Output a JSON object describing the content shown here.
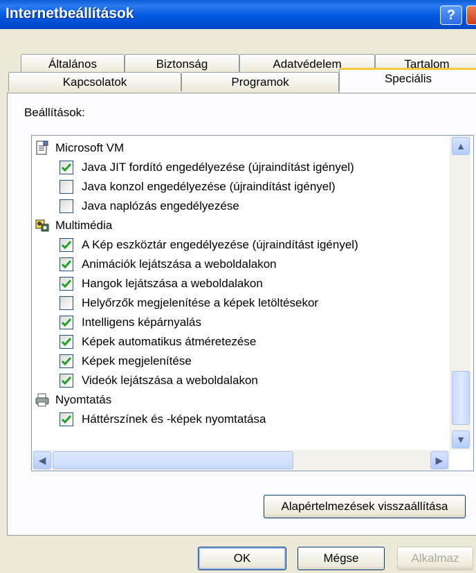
{
  "window": {
    "title": "Internetbeállítások"
  },
  "tabs_row1": [
    "Általános",
    "Biztonság",
    "Adatvédelem",
    "Tartalom"
  ],
  "tabs_row2": [
    "Kapcsolatok",
    "Programok",
    "Speciális"
  ],
  "panel": {
    "settings_label": "Beállítások:"
  },
  "list": [
    {
      "type": "category",
      "icon": "document-icon",
      "label": "Microsoft VM"
    },
    {
      "type": "checkbox",
      "checked": true,
      "label": "Java JIT fordító engedélyezése (újraindítást igényel)"
    },
    {
      "type": "checkbox",
      "checked": false,
      "label": "Java konzol engedélyezése (újraindítást igényel)"
    },
    {
      "type": "checkbox",
      "checked": false,
      "label": "Java naplózás engedélyezése"
    },
    {
      "type": "category",
      "icon": "multimedia-icon",
      "label": "Multimédia"
    },
    {
      "type": "checkbox",
      "checked": true,
      "label": "A Kép eszköztár engedélyezése (újraindítást igényel)"
    },
    {
      "type": "checkbox",
      "checked": true,
      "label": "Animációk lejátszása a weboldalakon"
    },
    {
      "type": "checkbox",
      "checked": true,
      "label": "Hangok lejátszása a weboldalakon"
    },
    {
      "type": "checkbox",
      "checked": false,
      "label": "Helyőrzők megjelenítése a képek letöltésekor"
    },
    {
      "type": "checkbox",
      "checked": true,
      "label": "Intelligens képárnyalás"
    },
    {
      "type": "checkbox",
      "checked": true,
      "label": "Képek automatikus átméretezése"
    },
    {
      "type": "checkbox",
      "checked": true,
      "label": "Képek megjelenítése"
    },
    {
      "type": "checkbox",
      "checked": true,
      "label": "Videók lejátszása a weboldalakon"
    },
    {
      "type": "category",
      "icon": "printer-icon",
      "label": "Nyomtatás"
    },
    {
      "type": "checkbox",
      "checked": true,
      "label": "Háttérszínek és -képek nyomtatása"
    }
  ],
  "buttons": {
    "restore_defaults": "Alapértelmezések visszaállítása",
    "ok": "OK",
    "cancel": "Mégse",
    "apply": "Alkalmaz"
  },
  "colors": {
    "titlebar": "#0058e0",
    "checkmark": "#21a121",
    "dialog_bg": "#ece9d8",
    "tab_highlight": "#ffc83c"
  }
}
